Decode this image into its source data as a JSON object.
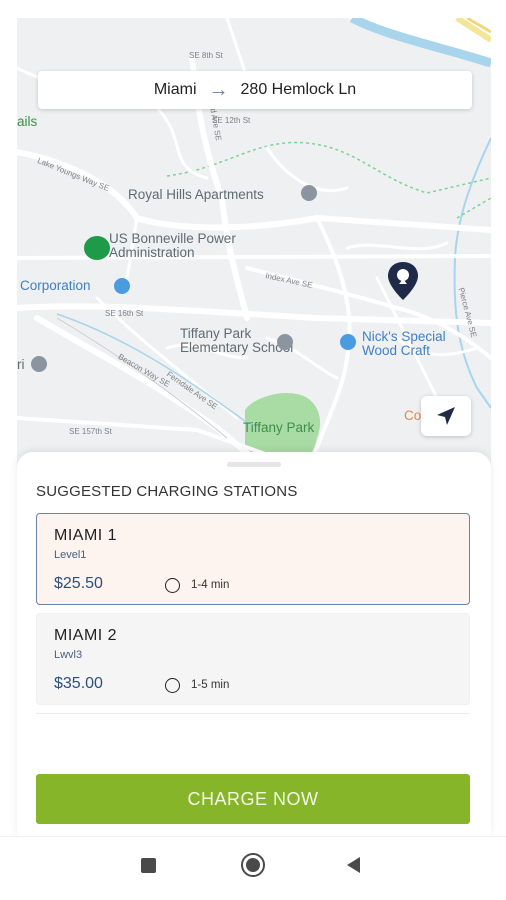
{
  "route": {
    "from": "Miami",
    "arrow": "→",
    "to": "280 Hemlock Ln"
  },
  "map": {
    "labels": {
      "royal_hills": "Royal Hills Apartments",
      "bonneville_line1": "US Bonneville Power",
      "bonneville_line2": "Administration",
      "corporation": "Corporation",
      "tiffany_school_line1": "Tiffany Park",
      "tiffany_school_line2": "Elementary School",
      "nicks_line1": "Nick's Special",
      "nicks_line2": "Wood Craft",
      "tiffany_park": "Tiffany Park",
      "ails": "ails",
      "ri": "ri",
      "co_by": "Co... By"
    },
    "streets": {
      "se8th": "SE 8th St",
      "se12th": "SE 12th St",
      "lake_youngs": "Lake Youngs Way SE",
      "index_ave": "Index Ave SE",
      "se16th": "SE 16th St",
      "beacon_way": "Beacon Way SE",
      "ferndale": "Ferndale Ave SE",
      "se157th": "SE 157th St",
      "pierce": "Pierce Ave SE",
      "kirkland": "Kirkland Ave SE"
    },
    "colors": {
      "water": "#a8d4ec",
      "park": "#a9dba4",
      "poi": "#4b9be0",
      "pin": "#1e2a48",
      "start": "#1e9a48"
    }
  },
  "sheet": {
    "title": "SUGGESTED CHARGING STATIONS",
    "stations": [
      {
        "name": "MIAMI 1",
        "level": "Level1",
        "price": "$25.50",
        "eta": "1-4 min",
        "selected": true
      },
      {
        "name": "MIAMI 2",
        "level": "Lwvl3",
        "price": "$35.00",
        "eta": "1-5 min",
        "selected": false
      }
    ]
  },
  "cta": {
    "label": "CHARGE NOW",
    "color": "#87b52a"
  },
  "icons": {
    "route": "arrow-right-icon",
    "locate": "navigation-arrow-icon",
    "pin": "map-pin-icon",
    "clock": "clock-icon",
    "nav": [
      "recents-square-icon",
      "home-circle-icon",
      "back-triangle-icon"
    ]
  }
}
